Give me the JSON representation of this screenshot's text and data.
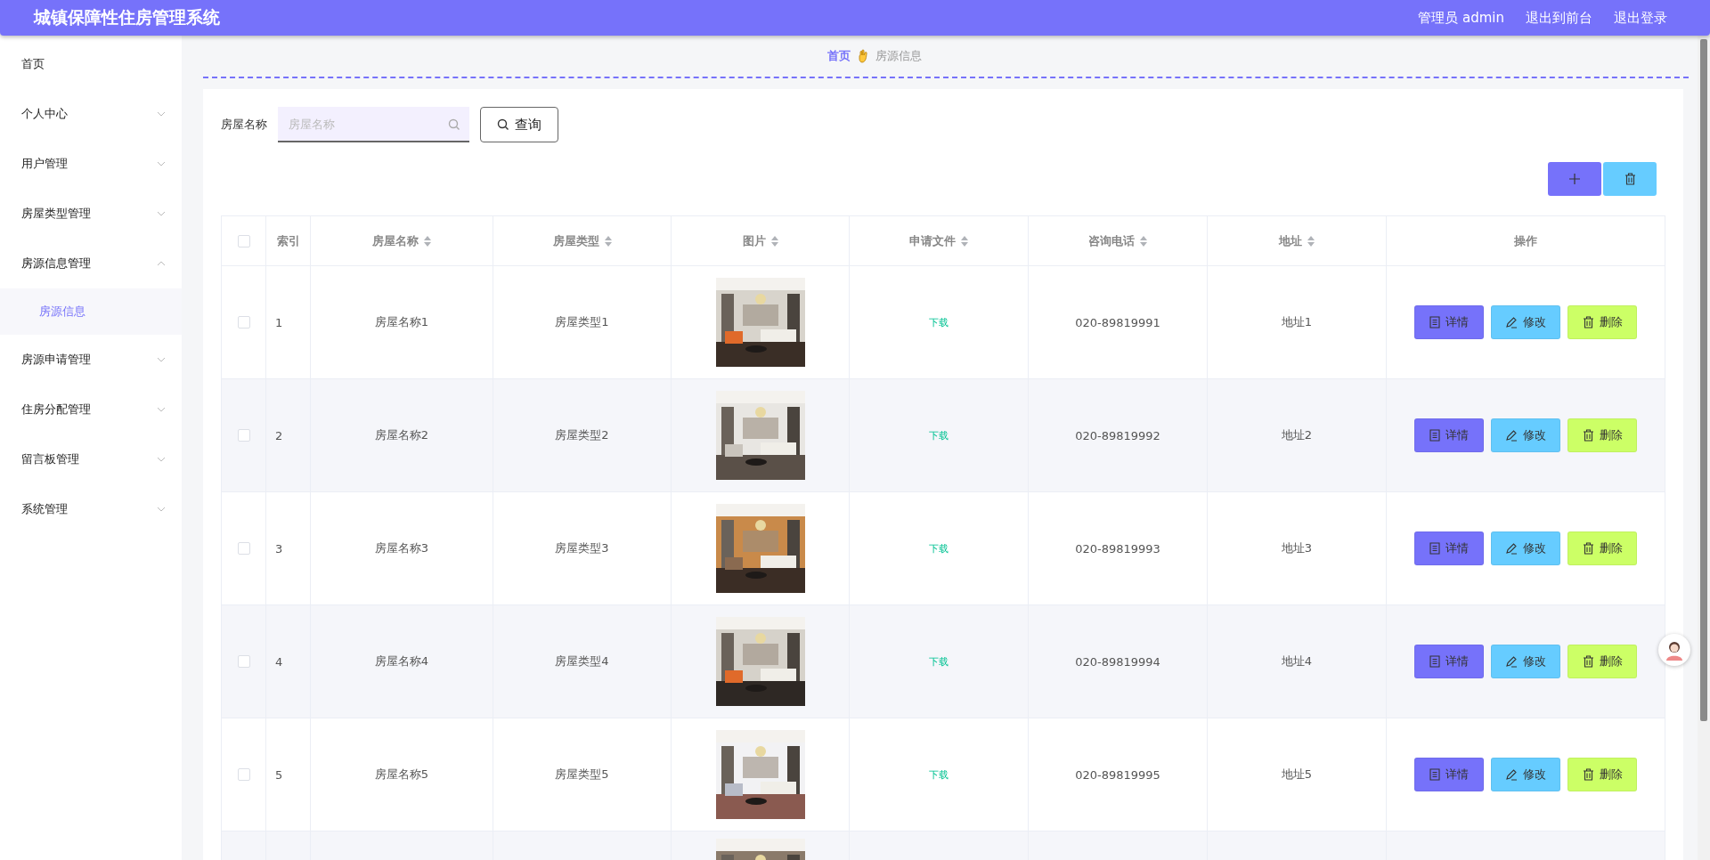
{
  "header": {
    "title": "城镇保障性住房管理系统",
    "links": [
      "管理员 admin",
      "退出到前台",
      "退出登录"
    ]
  },
  "sidebar": {
    "items": [
      {
        "kind": "link",
        "label": "首页"
      },
      {
        "kind": "group",
        "label": "个人中心",
        "expanded": false
      },
      {
        "kind": "group",
        "label": "用户管理",
        "expanded": false
      },
      {
        "kind": "group",
        "label": "房屋类型管理",
        "expanded": false
      },
      {
        "kind": "group",
        "label": "房源信息管理",
        "expanded": true,
        "children": [
          {
            "label": "房源信息",
            "selected": true
          }
        ]
      },
      {
        "kind": "group",
        "label": "房源申请管理",
        "expanded": false
      },
      {
        "kind": "group",
        "label": "住房分配管理",
        "expanded": false
      },
      {
        "kind": "group",
        "label": "留言板管理",
        "expanded": false
      },
      {
        "kind": "group",
        "label": "系统管理",
        "expanded": false
      }
    ]
  },
  "breadcrumb": [
    "首页",
    "房源信息"
  ],
  "search": {
    "label": "房屋名称",
    "placeholder": "房屋名称",
    "button": "查询"
  },
  "table": {
    "select_all_checked": false,
    "columns": [
      {
        "label": "索引",
        "sortable": false
      },
      {
        "label": "房屋名称",
        "sortable": true
      },
      {
        "label": "房屋类型",
        "sortable": true
      },
      {
        "label": "图片",
        "sortable": true
      },
      {
        "label": "申请文件",
        "sortable": true
      },
      {
        "label": "咨询电话",
        "sortable": true
      },
      {
        "label": "地址",
        "sortable": true
      },
      {
        "label": "操作",
        "sortable": false
      }
    ],
    "rows": [
      {
        "kind": "full",
        "checked": false,
        "index": "1",
        "name": "房屋名称1",
        "type": "房屋类型1",
        "file": "下载",
        "phone": "020-89819991",
        "address": "地址1",
        "actions": [
          {
            "kind": "detail",
            "label": "详情"
          },
          {
            "kind": "edit",
            "label": "修改"
          },
          {
            "kind": "delete",
            "label": "删除"
          }
        ]
      },
      {
        "kind": "full",
        "checked": false,
        "index": "2",
        "name": "房屋名称2",
        "type": "房屋类型2",
        "file": "下载",
        "phone": "020-89819992",
        "address": "地址2",
        "actions": [
          {
            "kind": "detail",
            "label": "详情"
          },
          {
            "kind": "edit",
            "label": "修改"
          },
          {
            "kind": "delete",
            "label": "删除"
          }
        ]
      },
      {
        "kind": "full",
        "checked": false,
        "index": "3",
        "name": "房屋名称3",
        "type": "房屋类型3",
        "file": "下载",
        "phone": "020-89819993",
        "address": "地址3",
        "actions": [
          {
            "kind": "detail",
            "label": "详情"
          },
          {
            "kind": "edit",
            "label": "修改"
          },
          {
            "kind": "delete",
            "label": "删除"
          }
        ]
      },
      {
        "kind": "full",
        "checked": false,
        "index": "4",
        "name": "房屋名称4",
        "type": "房屋类型4",
        "file": "下载",
        "phone": "020-89819994",
        "address": "地址4",
        "actions": [
          {
            "kind": "detail",
            "label": "详情"
          },
          {
            "kind": "edit",
            "label": "修改"
          },
          {
            "kind": "delete",
            "label": "删除"
          }
        ]
      },
      {
        "kind": "full",
        "checked": false,
        "index": "5",
        "name": "房屋名称5",
        "type": "房屋类型5",
        "file": "下载",
        "phone": "020-89819995",
        "address": "地址5",
        "actions": [
          {
            "kind": "detail",
            "label": "详情"
          },
          {
            "kind": "edit",
            "label": "修改"
          },
          {
            "kind": "delete",
            "label": "删除"
          }
        ]
      },
      {
        "kind": "partial"
      }
    ]
  }
}
